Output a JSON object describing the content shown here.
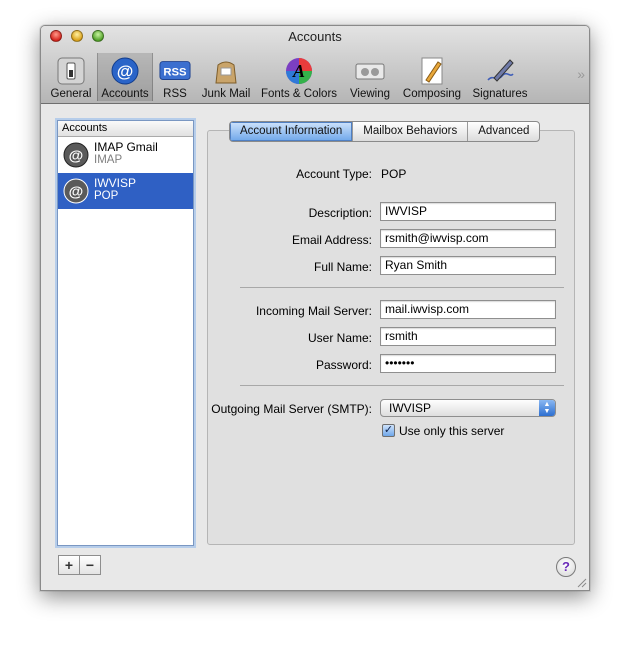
{
  "window": {
    "title": "Accounts"
  },
  "toolbar": {
    "items": [
      {
        "label": "General",
        "icon": "general-switch-icon"
      },
      {
        "label": "Accounts",
        "icon": "at-sign-icon"
      },
      {
        "label": "RSS",
        "icon": "rss-icon"
      },
      {
        "label": "Junk Mail",
        "icon": "junk-mail-bag-icon"
      },
      {
        "label": "Fonts & Colors",
        "icon": "fonts-colors-icon"
      },
      {
        "label": "Viewing",
        "icon": "viewing-icon"
      },
      {
        "label": "Composing",
        "icon": "composing-pencil-icon"
      },
      {
        "label": "Signatures",
        "icon": "signature-pen-icon"
      }
    ],
    "selected": "Accounts",
    "more_glyph": "»",
    "rss_badge": "RSS"
  },
  "sidebar": {
    "header": "Accounts",
    "accounts": [
      {
        "name": "IMAP Gmail",
        "type": "IMAP",
        "selected": false
      },
      {
        "name": "IWVISP",
        "type": "POP",
        "selected": true
      }
    ],
    "add_label": "+",
    "remove_label": "−"
  },
  "tabs": [
    {
      "label": "Account Information",
      "active": true
    },
    {
      "label": "Mailbox Behaviors",
      "active": false
    },
    {
      "label": "Advanced",
      "active": false
    }
  ],
  "form": {
    "account_type_label": "Account Type:",
    "account_type_value": "POP",
    "description_label": "Description:",
    "description_value": "IWVISP",
    "email_label": "Email Address:",
    "email_value": "rsmith@iwvisp.com",
    "fullname_label": "Full Name:",
    "fullname_value": "Ryan Smith",
    "incoming_label": "Incoming Mail Server:",
    "incoming_value": "mail.iwvisp.com",
    "username_label": "User Name:",
    "username_value": "rsmith",
    "password_label": "Password:",
    "password_value": "•••••••",
    "smtp_label": "Outgoing Mail Server (SMTP):",
    "smtp_value": "IWVISP",
    "use_only_label": "Use only this server",
    "use_only_checked": true
  },
  "help_label": "?",
  "colors": {
    "selection": "#2f60c4",
    "focus_ring": "#b6cdea",
    "help_glyph": "#6a2ab8"
  }
}
